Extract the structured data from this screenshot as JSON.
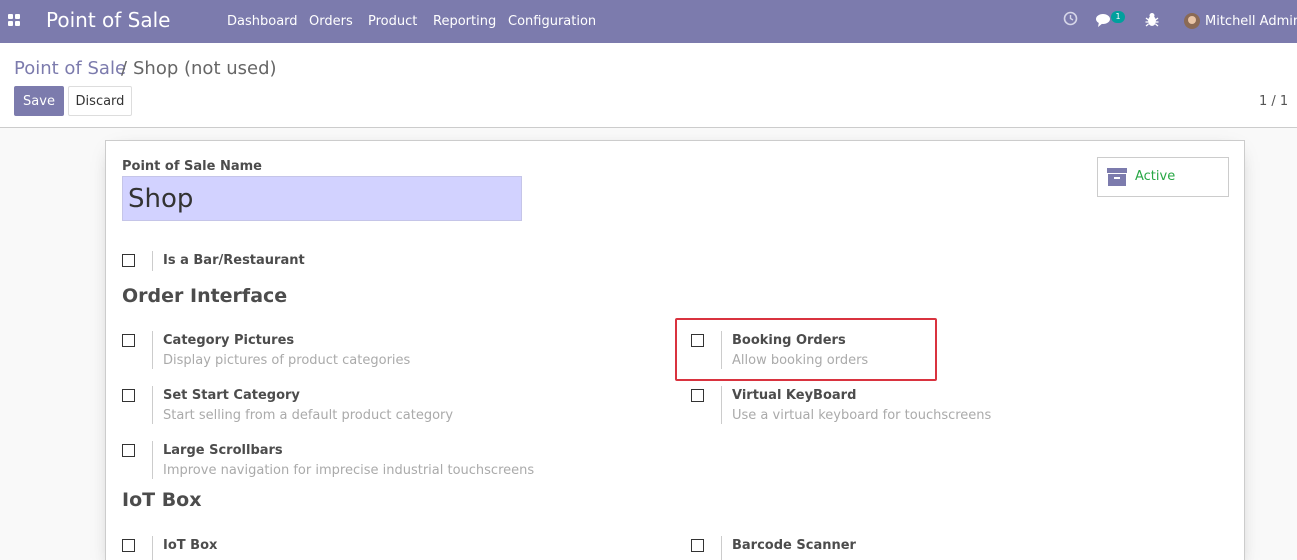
{
  "navbar": {
    "brand": "Point of Sale",
    "menu": [
      "Dashboard",
      "Orders",
      "Product",
      "Reporting",
      "Configuration"
    ],
    "messages_badge": "1",
    "user_name": "Mitchell Admin",
    "icons": [
      "apps-grid-icon",
      "clock-icon",
      "chat-icon",
      "bug-icon"
    ]
  },
  "breadcrumb": {
    "parent": "Point of Sale",
    "separator": "/",
    "current": "Shop (not used)"
  },
  "buttons": {
    "save": "Save",
    "discard": "Discard"
  },
  "pager": "1 / 1",
  "form": {
    "name_label": "Point of Sale Name",
    "name_value": "Shop",
    "active_label": "Active",
    "is_bar_label": "Is a Bar/Restaurant",
    "section_order_interface": "Order Interface",
    "section_iot": "IoT Box",
    "options": {
      "category_pictures": {
        "title": "Category Pictures",
        "desc": "Display pictures of product categories"
      },
      "booking_orders": {
        "title": "Booking Orders",
        "desc": "Allow booking orders"
      },
      "set_start_category": {
        "title": "Set Start Category",
        "desc": "Start selling from a default product category"
      },
      "virtual_keyboard": {
        "title": "Virtual KeyBoard",
        "desc": "Use a virtual keyboard for touchscreens"
      },
      "large_scrollbars": {
        "title": "Large Scrollbars",
        "desc": "Improve navigation for imprecise industrial touchscreens"
      },
      "iot_box": {
        "title": "IoT Box"
      },
      "barcode_scanner": {
        "title": "Barcode Scanner"
      }
    }
  },
  "colors": {
    "brand": "#7c7bad",
    "highlight": "#d9333f",
    "active": "#28a745",
    "input_bg": "#d2d2ff"
  }
}
